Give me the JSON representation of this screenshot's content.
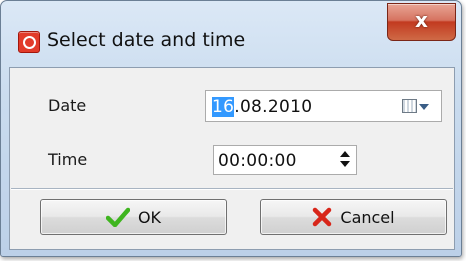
{
  "window": {
    "title": "Select date and time",
    "app_icon": "red-circle-app-icon",
    "close_glyph": "x"
  },
  "form": {
    "date_label": "Date",
    "date_value_selected": "16",
    "date_value_rest": ".08.2010",
    "time_label": "Time",
    "time_value": "00:00:00"
  },
  "buttons": {
    "ok_label": "OK",
    "cancel_label": "Cancel"
  },
  "colors": {
    "selection": "#3399ff",
    "ok_check": "#3fb51f",
    "cancel_x": "#d8261a",
    "close_button": "#c9462b"
  },
  "icons": {
    "calendar": "calendar-icon",
    "dropdown": "chevron-down-icon",
    "spinner": "up-down-arrows-icon",
    "ok": "checkmark-icon",
    "cancel": "red-x-icon"
  }
}
